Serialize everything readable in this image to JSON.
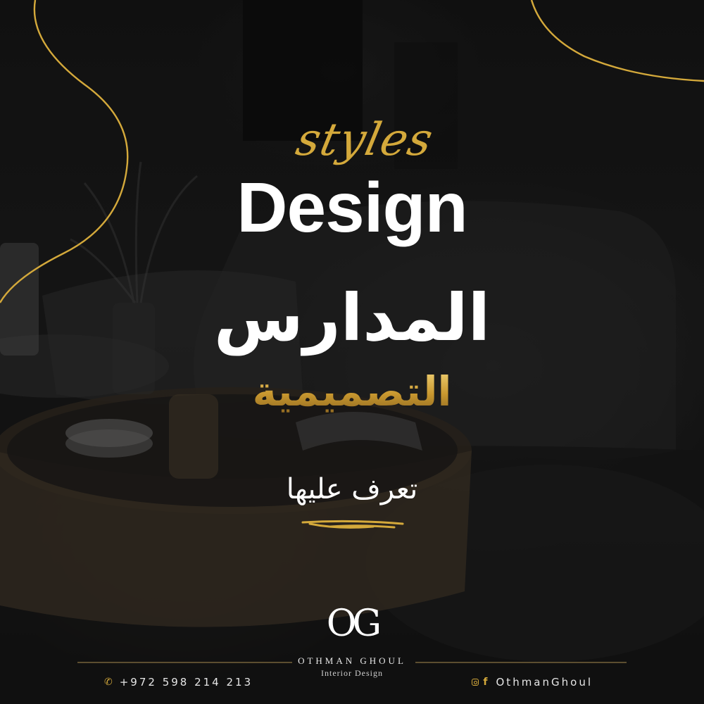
{
  "headline": {
    "script_word": "styles",
    "main_word": "Design",
    "arabic_title": "المدارس",
    "arabic_subtitle": "التصميمية",
    "arabic_cta": "تعرف عليها"
  },
  "brand": {
    "monogram": "OG",
    "name": "OTHMAN GHOUL",
    "tagline": "Interior Design"
  },
  "footer": {
    "phone": "+972 598 214 213",
    "phone_icon": "phone-icon",
    "social_handle": "OthmanGhoul",
    "social_icons": [
      "instagram-icon",
      "facebook-icon"
    ]
  },
  "colors": {
    "gold": "#d4a93b",
    "background": "#1a1a1a",
    "text": "#ffffff"
  }
}
